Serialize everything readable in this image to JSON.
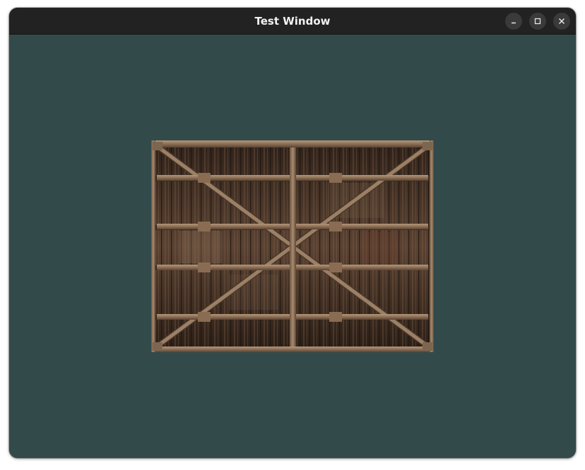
{
  "window": {
    "title": "Test Window",
    "controls": [
      "minimize-icon",
      "maximize-icon",
      "close-icon"
    ],
    "background_color": "#334a4a",
    "titlebar_color": "#222222"
  },
  "content": {
    "image": "wooden-plank-ceiling-texture"
  }
}
